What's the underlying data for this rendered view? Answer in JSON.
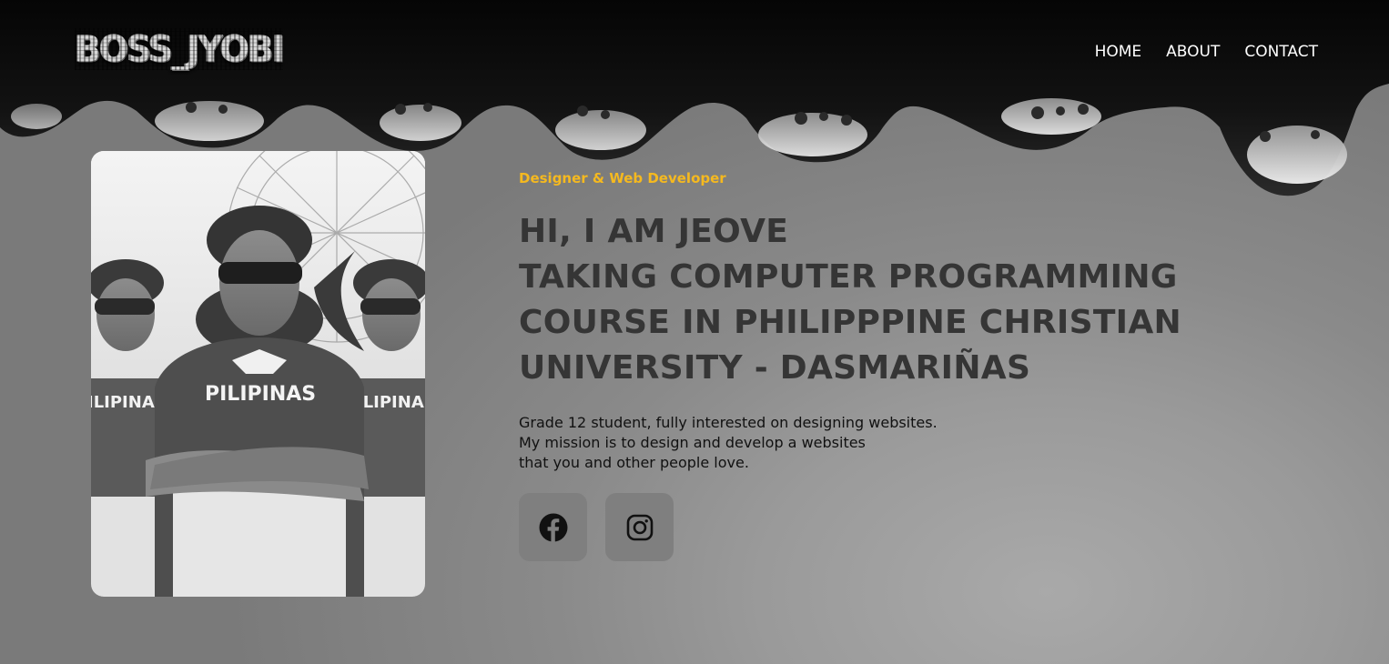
{
  "brand": {
    "logo_text": "BOSS_JYOBI"
  },
  "nav": {
    "items": [
      {
        "label": "HOME"
      },
      {
        "label": "ABOUT"
      },
      {
        "label": "CONTACT"
      }
    ]
  },
  "profile": {
    "jersey_text": "PILIPINAS"
  },
  "hero": {
    "role": "Designer & Web Developer",
    "heading_lines": [
      "HI, I AM JEOVE",
      "TAKING COMPUTER PROGRAMMING",
      "COURSE IN PHILIPPPINE CHRISTIAN",
      "UNIVERSITY - DASMARIÑAS"
    ],
    "description_lines": [
      "Grade 12 student, fully interested on designing websites.",
      "My mission is to design and develop a websites",
      "that you and other people love."
    ]
  },
  "social": {
    "buttons": [
      {
        "icon": "facebook-icon"
      },
      {
        "icon": "instagram-icon"
      }
    ]
  },
  "colors": {
    "accent": "#f5b91f",
    "heading": "#353535",
    "body_text": "#111111",
    "social_bg": "#7f7f7f",
    "top_band": "#080808"
  }
}
